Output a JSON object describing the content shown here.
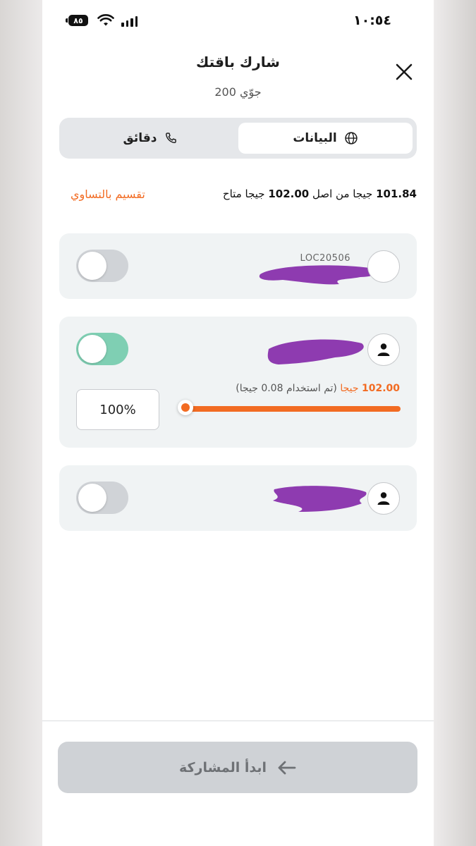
{
  "status_bar": {
    "time": "١٠:٥٤",
    "battery": "٨٥"
  },
  "header": {
    "title": "شارك باقتك",
    "subtitle": "جوّي 200"
  },
  "tabs": [
    {
      "label": "البيانات",
      "icon": "globe-icon",
      "selected": true
    },
    {
      "label": "دقائق",
      "icon": "phone-icon",
      "selected": false
    }
  ],
  "summary": {
    "available": "101.84",
    "available_unit": "جيجا من اصل",
    "total": "102.00",
    "total_unit": "جيجا متاح",
    "split_equally": "تقسيم بالتساوي"
  },
  "members": [
    {
      "code": "LOC20506",
      "enabled": false
    },
    {
      "enabled": true,
      "amount": "102.00",
      "amount_unit": "جيجا",
      "used_note": "(تم استخدام 0.08 جيجا)",
      "percent_label": "100%",
      "share_fraction": 1.0
    },
    {
      "enabled": false
    }
  ],
  "footer": {
    "start_label": "ابدأ المشاركة"
  },
  "colors": {
    "accent": "#f26b22",
    "toggle_on": "#7fcfb3",
    "redaction": "#8e3bb0"
  }
}
